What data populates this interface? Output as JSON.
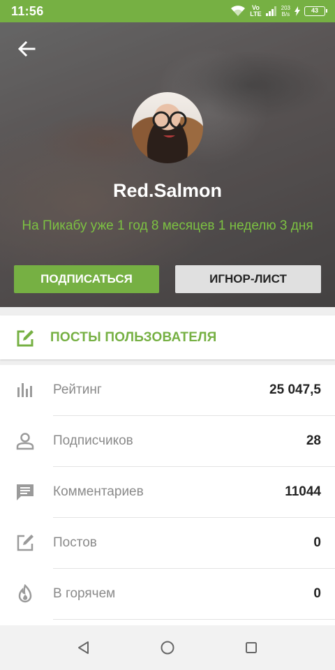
{
  "status_bar": {
    "time": "11:56",
    "volte_top": "Vo",
    "volte_bottom": "LTE",
    "net_speed_value": "203",
    "net_speed_unit": "B/s",
    "battery_level": "43",
    "icons": [
      "wifi-icon",
      "signal-icon",
      "charging-icon",
      "battery-icon"
    ]
  },
  "header": {
    "back_icon": "arrow-left-icon",
    "username": "Red.Salmon",
    "member_since": "На Пикабу уже 1 год 8 месяцев 1 неделю 3 дня",
    "subscribe_label": "ПОДПИСАТЬСЯ",
    "ignore_label": "ИГНОР-ЛИСТ"
  },
  "posts_link": {
    "icon": "edit-square-icon",
    "label": "ПОСТЫ ПОЛЬЗОВАТЕЛЯ"
  },
  "stats": [
    {
      "icon": "bar-chart-icon",
      "label": "Рейтинг",
      "value": "25 047,5"
    },
    {
      "icon": "person-icon",
      "label": "Подписчиков",
      "value": "28"
    },
    {
      "icon": "comment-icon",
      "label": "Комментариев",
      "value": "11044"
    },
    {
      "icon": "edit-square-icon",
      "label": "Постов",
      "value": "0"
    },
    {
      "icon": "flame-icon",
      "label": "В горячем",
      "value": "0"
    }
  ],
  "colors": {
    "accent": "#76b043",
    "since_text": "#7cc142",
    "ignore_button": "#e0e0e0"
  },
  "nav_bar": {
    "icons": [
      "back-triangle-icon",
      "home-circle-icon",
      "recents-square-icon"
    ]
  }
}
